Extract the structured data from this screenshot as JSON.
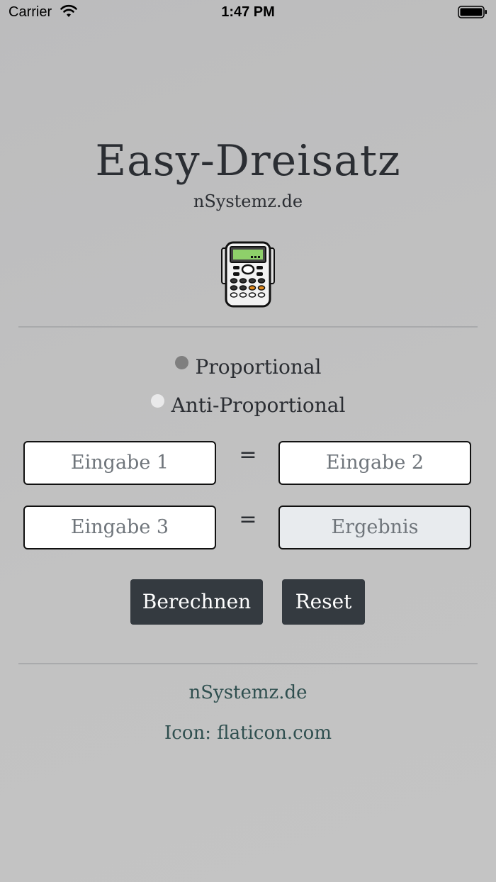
{
  "status": {
    "carrier": "Carrier",
    "time": "1:47 PM"
  },
  "app": {
    "title": "Easy-Dreisatz",
    "subtitle": "nSystemz.de"
  },
  "mode": {
    "options": [
      {
        "label": "Proportional",
        "selected": true
      },
      {
        "label": "Anti-Proportional",
        "selected": false
      }
    ]
  },
  "inputs": {
    "eingabe1": {
      "placeholder": "Eingabe 1",
      "value": ""
    },
    "eingabe2": {
      "placeholder": "Eingabe 2",
      "value": ""
    },
    "eingabe3": {
      "placeholder": "Eingabe 3",
      "value": ""
    },
    "ergebnis": {
      "placeholder": "Ergebnis",
      "value": ""
    },
    "equals": "="
  },
  "buttons": {
    "calculate": "Berechnen",
    "reset": "Reset"
  },
  "footer": {
    "site_link": "nSystemz.de",
    "icon_credit": "Icon: flaticon.com"
  },
  "colors": {
    "button_bg": "#343a40",
    "link": "#2f4f4f",
    "title": "#2b2e33"
  },
  "icons": {
    "app_icon": "calculator-icon",
    "wifi": "wifi-icon",
    "battery": "battery-icon"
  }
}
